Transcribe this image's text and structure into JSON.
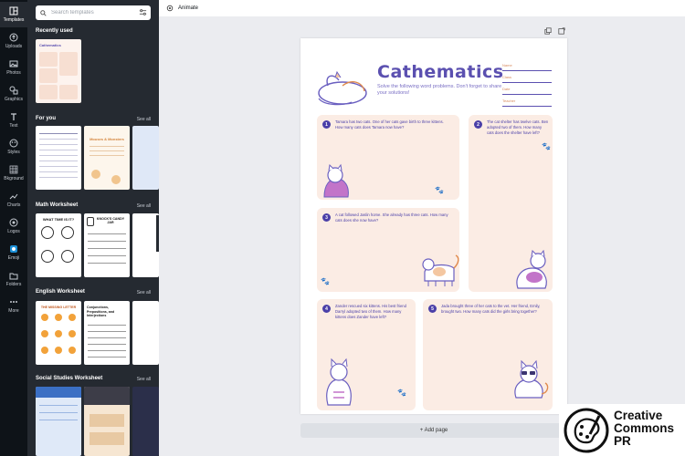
{
  "rail": {
    "items": [
      {
        "label": "Templates",
        "icon": "templates-icon"
      },
      {
        "label": "Uploads",
        "icon": "upload-icon"
      },
      {
        "label": "Photos",
        "icon": "photo-icon"
      },
      {
        "label": "Graphics",
        "icon": "graphics-icon"
      },
      {
        "label": "Text",
        "icon": "text-icon"
      },
      {
        "label": "Styles",
        "icon": "styles-icon"
      },
      {
        "label": "Bkground",
        "icon": "background-icon"
      },
      {
        "label": "Charts",
        "icon": "charts-icon"
      },
      {
        "label": "Logos",
        "icon": "logos-icon"
      },
      {
        "label": "Emoji",
        "icon": "emoji-icon"
      },
      {
        "label": "Folders",
        "icon": "folder-icon"
      },
      {
        "label": "More",
        "icon": "more-icon"
      }
    ]
  },
  "panel": {
    "search_placeholder": "Search templates",
    "sections": [
      {
        "title": "Recently used",
        "see_all": ""
      },
      {
        "title": "For you",
        "see_all": "See all"
      },
      {
        "title": "Math Worksheet",
        "see_all": "See all"
      },
      {
        "title": "English Worksheet",
        "see_all": "See all"
      },
      {
        "title": "Social Studies Worksheet",
        "see_all": "See all"
      }
    ],
    "thumb_texts": {
      "recent": "Cathematics",
      "for_you_2": "Mouses & Monsters",
      "math_1": "WHAT TIME IS IT?",
      "math_2": "KNOCK'S CANDY JAR",
      "english_1": "THE MISSING LETTER",
      "english_2": "Conjunctions, Prepositions, and Interjections"
    }
  },
  "topbar": {
    "animate_label": "Animate"
  },
  "worksheet": {
    "title": "Cathematics",
    "subtitle": "Solve the following word problems. Don't forget to share your solutions!",
    "fields": [
      "Name",
      "Class",
      "Date",
      "Teacher"
    ],
    "questions": [
      {
        "num": "1",
        "text": "Tamara has two cats. One of her cats gave birth to three kittens. How many cats does Tamara now have?"
      },
      {
        "num": "2",
        "text": "The cat shelter has twelve cats. Ben adopted two of them. How many cats does the shelter have left?"
      },
      {
        "num": "3",
        "text": "A cat followed Jaslin home. She already has three cats. How many cats does she now have?"
      },
      {
        "num": "4",
        "text": "Zander rescued six kittens. His best friend Darryl adopted two of them. How many kittens does Zander have left?"
      },
      {
        "num": "5",
        "text": "Jada brought three of her cats to the vet. Her friend, Emily, brought two. How many cats did the girls bring together?"
      }
    ]
  },
  "canvas": {
    "add_page_label": "+ Add page"
  },
  "watermark": {
    "line1": "Creative",
    "line2": "Commons",
    "line3": "PR"
  },
  "colors": {
    "accent": "#5b50b0",
    "card": "#fbece4",
    "paw": "#e08a4c",
    "sidebar": "#252a31",
    "rail": "#0e1318"
  }
}
